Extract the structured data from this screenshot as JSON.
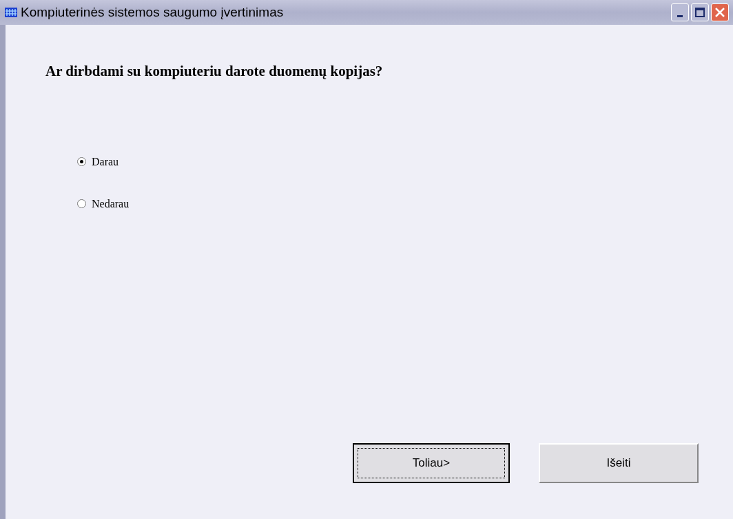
{
  "window": {
    "title": "Kompiuterinės sistemos saugumo įvertinimas"
  },
  "question": "Ar dirbdami su kompiuteriu darote duomenų kopijas?",
  "options": [
    {
      "label": "Darau",
      "selected": true
    },
    {
      "label": "Nedarau",
      "selected": false
    }
  ],
  "buttons": [
    {
      "label": "Toliau>",
      "focused": true
    },
    {
      "label": "Išeiti",
      "focused": false
    }
  ]
}
